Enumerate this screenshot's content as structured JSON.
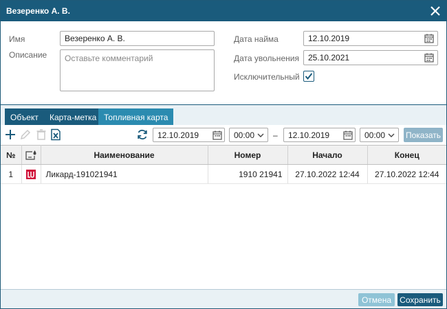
{
  "window": {
    "title": "Везеренко А. В."
  },
  "form": {
    "name_label": "Имя",
    "name_value": "Везеренко А. В.",
    "description_label": "Описание",
    "description_placeholder": "Оставьте комментарий",
    "hire_date_label": "Дата найма",
    "hire_date_value": "12.10.2019",
    "dismiss_date_label": "Дата увольнения",
    "dismiss_date_value": "25.10.2021",
    "exclusive_label": "Исключительный",
    "exclusive_checked": true
  },
  "tabs": [
    {
      "label": "Объект",
      "active": false
    },
    {
      "label": "Карта-метка",
      "active": false
    },
    {
      "label": "Топливная карта",
      "active": true
    }
  ],
  "toolbar": {
    "date_from": "12.10.2019",
    "time_from": "00:00",
    "range_dash": "–",
    "date_to": "12.10.2019",
    "time_to": "00:00",
    "show_label": "Показать"
  },
  "table": {
    "columns": [
      "№",
      "",
      "Наименование",
      "Номер",
      "Начало",
      "Конец"
    ],
    "rows": [
      {
        "num": "1",
        "logo": "lukoil-logo",
        "name": "Ликард-191021941",
        "number": "1910 21941",
        "start": "27.10.2022 12:44",
        "end": "27.10.2022 12:44"
      }
    ]
  },
  "footer": {
    "cancel_label": "Отмена",
    "save_label": "Сохранить"
  },
  "colors": {
    "primary": "#1a5b7c",
    "tab_active": "#2b8bb0",
    "lukoil_red": "#d0103a"
  }
}
